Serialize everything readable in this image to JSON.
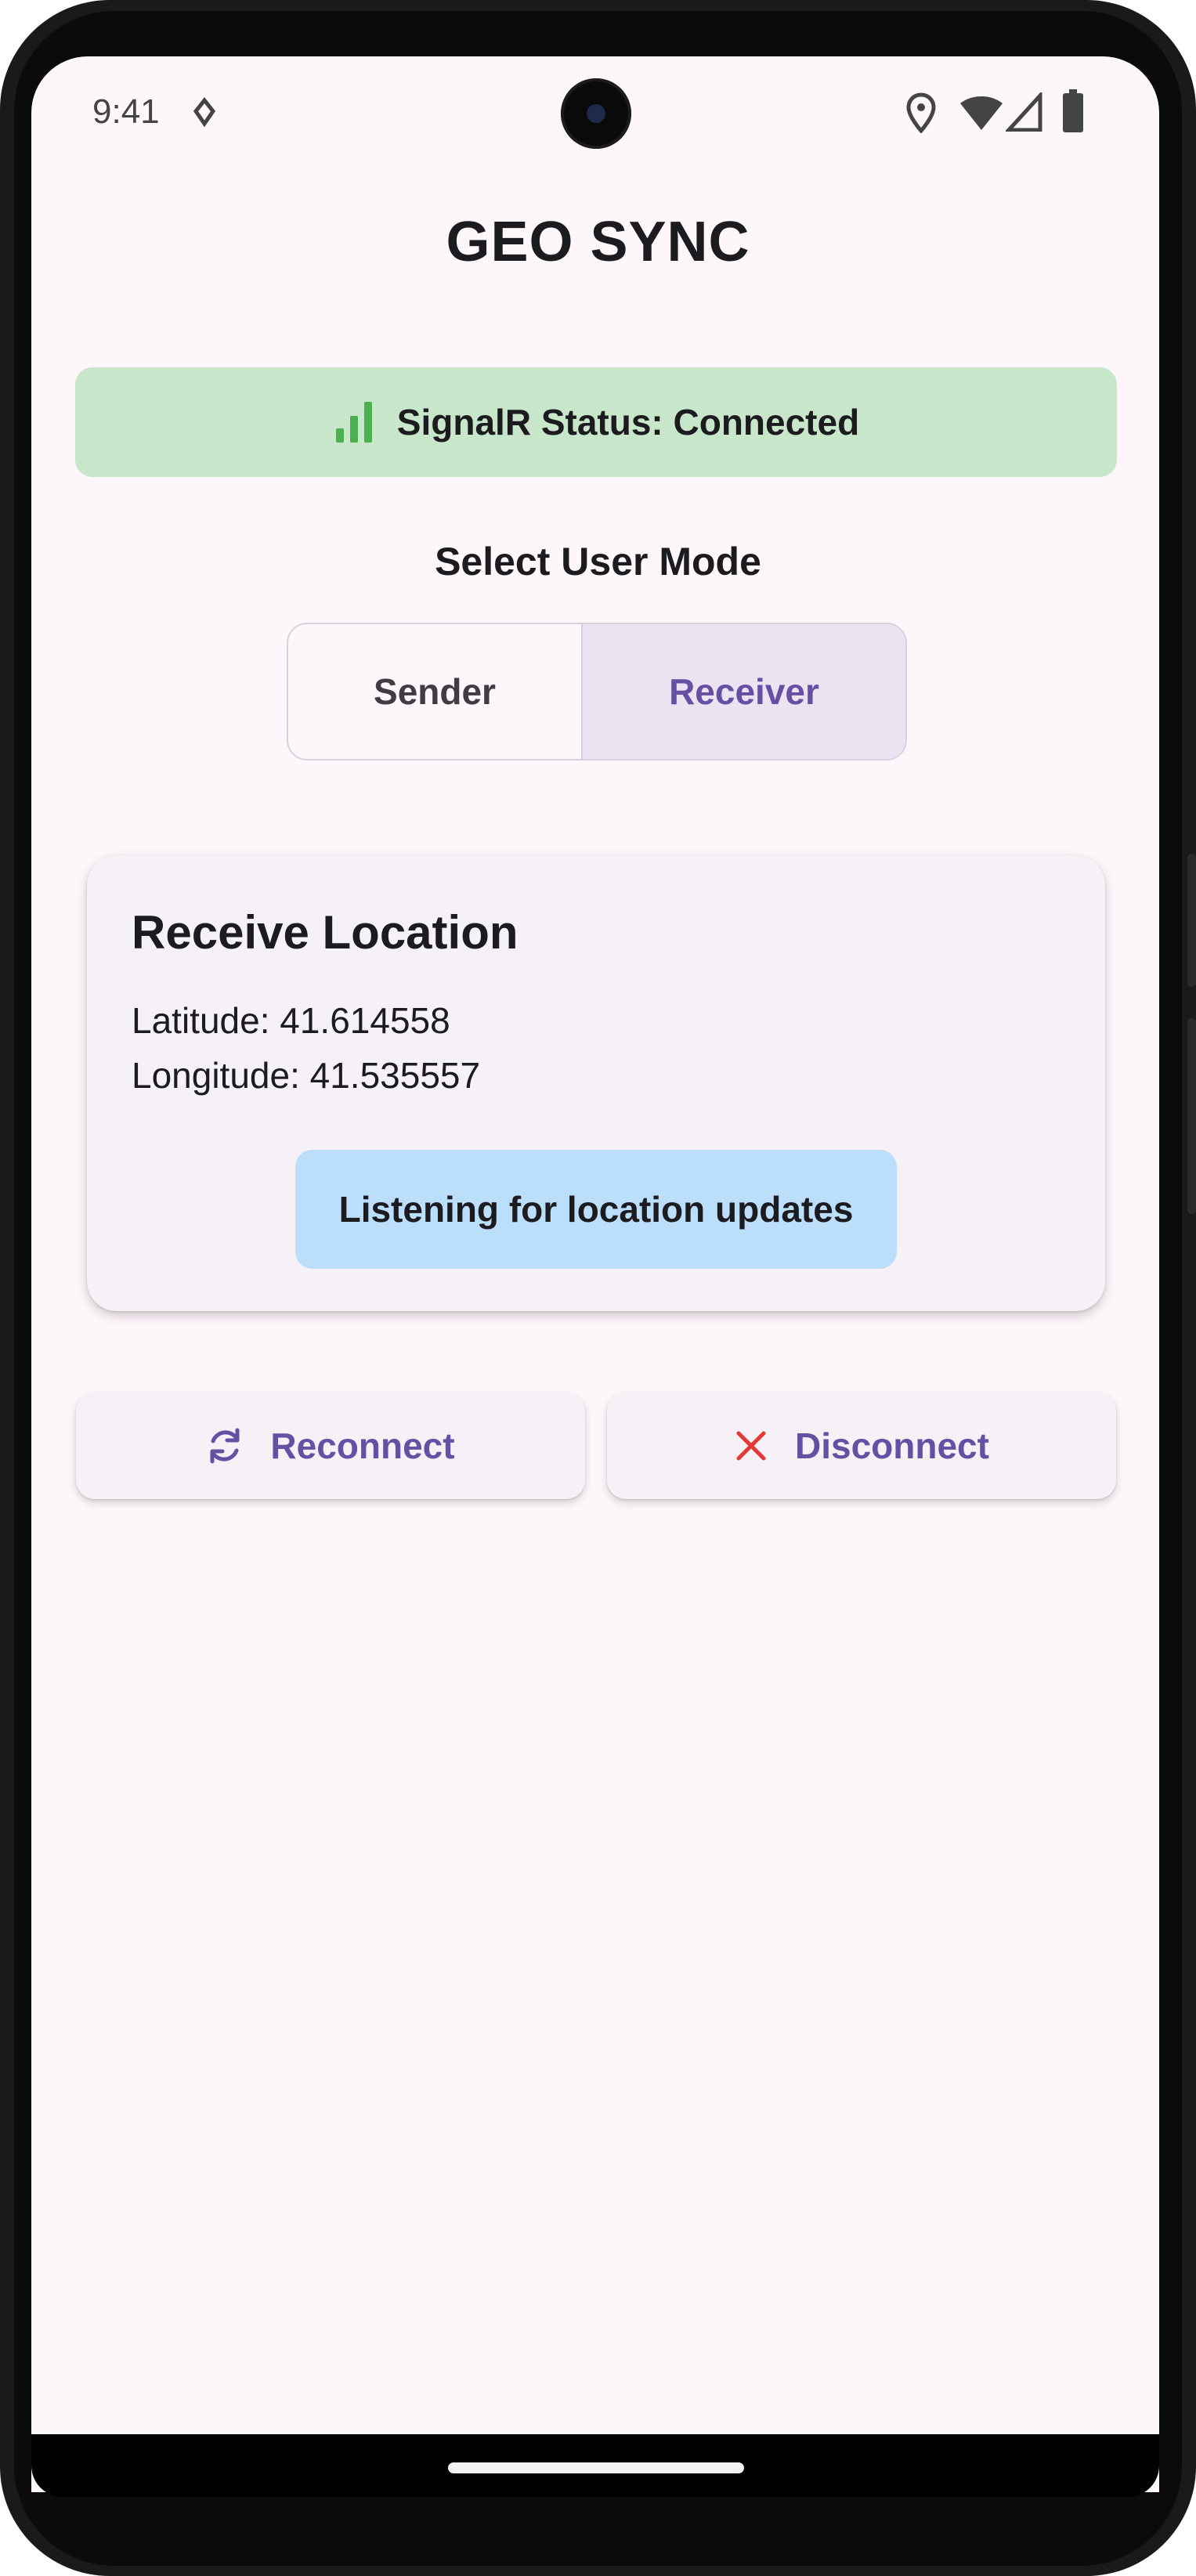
{
  "status_bar": {
    "time": "9:41"
  },
  "app": {
    "title": "GEO SYNC"
  },
  "connection": {
    "status_text": "SignalR Status: Connected",
    "status_color": "#4caf50",
    "banner_color": "#c8e6c9"
  },
  "mode_selector": {
    "heading": "Select User Mode",
    "options": [
      "Sender",
      "Receiver"
    ],
    "selected": "Receiver"
  },
  "receive_card": {
    "title": "Receive Location",
    "latitude_text": "Latitude: 41.614558",
    "longitude_text": "Longitude: 41.535557",
    "listening_text": "Listening for location updates"
  },
  "actions": {
    "reconnect_label": "Reconnect",
    "disconnect_label": "Disconnect"
  },
  "colors": {
    "accent": "#6650a4",
    "danger": "#e53935",
    "background": "#fdf6fb",
    "listening_bg": "#bbdefb"
  }
}
